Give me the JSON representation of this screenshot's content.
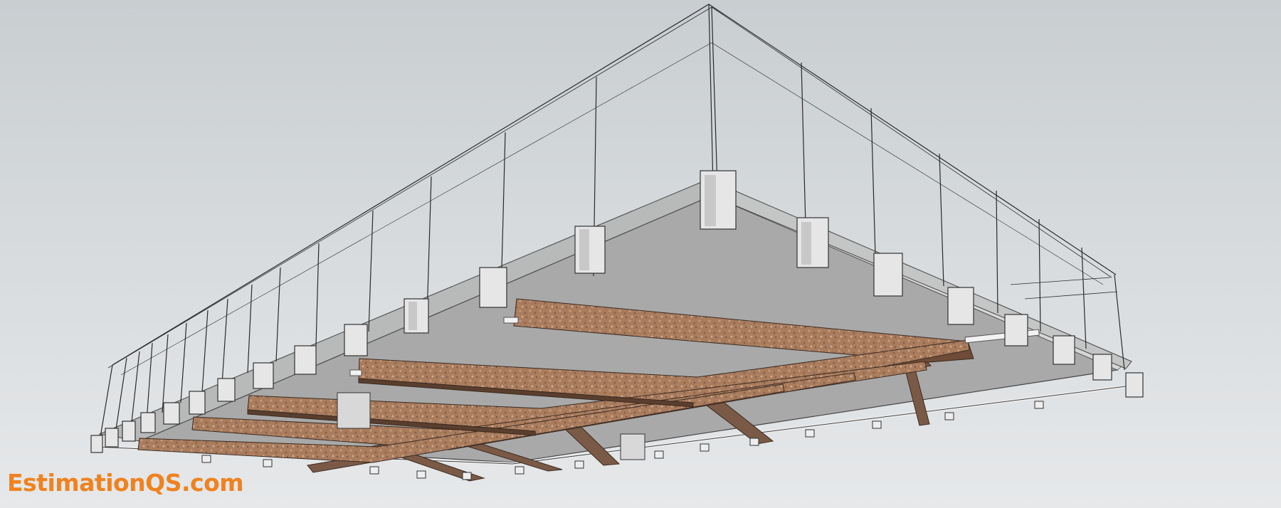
{
  "watermark": {
    "text": "EstimationQS.com",
    "color": "#f0821e"
  },
  "colors": {
    "background": "#d2d6d8",
    "slab_soffit": "#a9a9a9",
    "slab_edge": "#bcbcbc",
    "formwork_face": "#a87a5a",
    "bearer": "#7a5a46",
    "spacer_block": "#e6e6e6",
    "cage_edge": "#b9bcbc",
    "rebar": "#2a2a2a"
  },
  "scene_elements": [
    "slab",
    "reinforcement-cage",
    "edge-spacer-blocks",
    "formwork-panels",
    "timber-bearers",
    "props",
    "bottom-spacers",
    "pipes"
  ]
}
